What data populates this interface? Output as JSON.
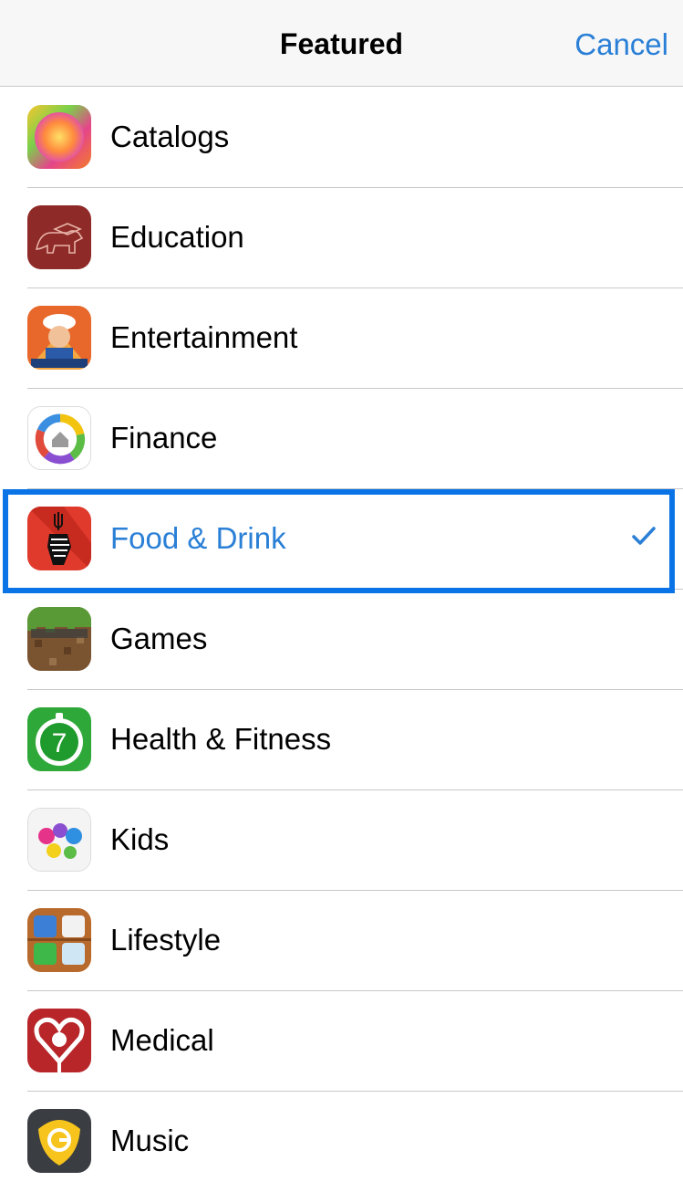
{
  "navbar": {
    "title": "Featured",
    "cancel_label": "Cancel"
  },
  "colors": {
    "accent": "#2a7fd6",
    "highlight_border": "#0a74e6",
    "separator": "#c8c7cc"
  },
  "categories": [
    {
      "label": "Catalogs",
      "icon": "catalogs-app-icon",
      "selected": false
    },
    {
      "label": "Education",
      "icon": "education-app-icon",
      "selected": false
    },
    {
      "label": "Entertainment",
      "icon": "entertainment-app-icon",
      "selected": false
    },
    {
      "label": "Finance",
      "icon": "finance-app-icon",
      "selected": false
    },
    {
      "label": "Food & Drink",
      "icon": "food-drink-app-icon",
      "selected": true
    },
    {
      "label": "Games",
      "icon": "games-app-icon",
      "selected": false
    },
    {
      "label": "Health & Fitness",
      "icon": "health-fitness-app-icon",
      "selected": false
    },
    {
      "label": "Kids",
      "icon": "kids-app-icon",
      "selected": false
    },
    {
      "label": "Lifestyle",
      "icon": "lifestyle-app-icon",
      "selected": false
    },
    {
      "label": "Medical",
      "icon": "medical-app-icon",
      "selected": false
    },
    {
      "label": "Music",
      "icon": "music-app-icon",
      "selected": false
    }
  ],
  "selected_indicator": "checkmark-icon"
}
